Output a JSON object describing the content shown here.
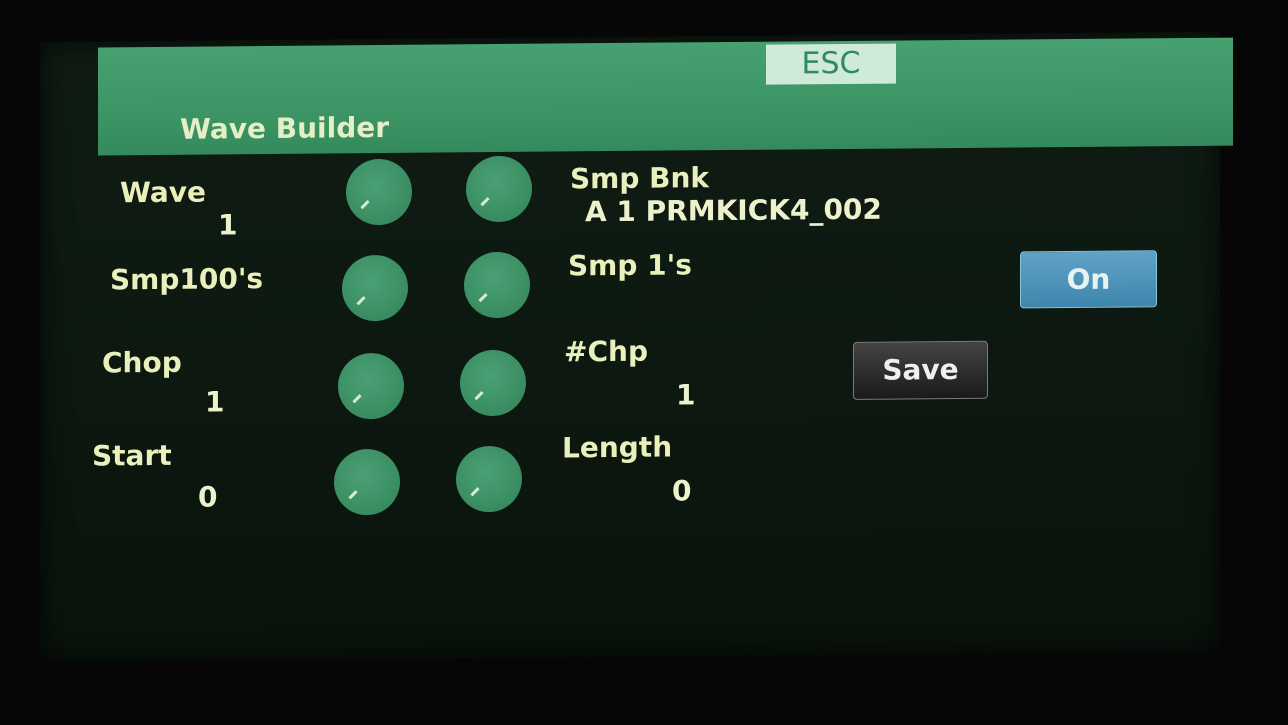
{
  "header": {
    "esc_label": "ESC",
    "title": "Wave Builder"
  },
  "params": {
    "wave": {
      "label": "Wave",
      "value": "1"
    },
    "smp100": {
      "label": "Smp100's"
    },
    "chop": {
      "label": "Chop",
      "value": "1"
    },
    "start": {
      "label": "Start",
      "value": "0"
    },
    "smp_bnk": {
      "label": "Smp Bnk",
      "value": "A  1 PRMKICK4_002"
    },
    "smp1": {
      "label": "Smp 1's"
    },
    "num_chp": {
      "label": "#Chp",
      "value": "1"
    },
    "length": {
      "label": "Length",
      "value": "0"
    }
  },
  "buttons": {
    "on_label": "On",
    "save_label": "Save"
  },
  "colors": {
    "header_green": "#3d9566",
    "knob_green": "#3b8f63",
    "on_blue": "#4a93ba",
    "text_cream": "#e9f0bb"
  }
}
